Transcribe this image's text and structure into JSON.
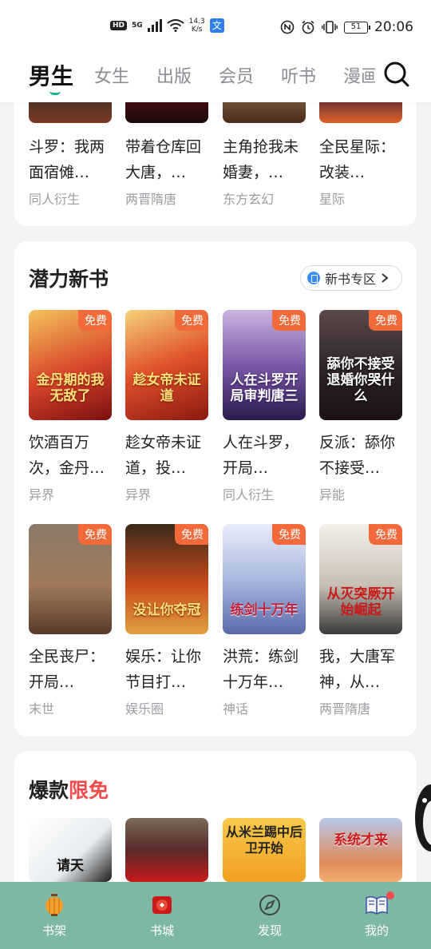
{
  "status_bar": {
    "hd": "HD",
    "network": "5G",
    "speed_value": "14.3",
    "speed_unit": "K/s",
    "translate_glyph": "文",
    "battery": "51",
    "time": "20:06",
    "icons": [
      "nfc-icon",
      "alarm-icon",
      "vibrate-icon"
    ]
  },
  "top_tabs": {
    "items": [
      "男生",
      "女生",
      "出版",
      "会员",
      "听书",
      "漫画"
    ],
    "active_index": 0,
    "accent": "#1ab394"
  },
  "card_prev": {
    "books": [
      {
        "title": "斗罗：我两面宿傩…",
        "tag": "同人衍生"
      },
      {
        "title": "带着仓库回大唐，…",
        "tag": "两晋隋唐"
      },
      {
        "title": "主角抢我未婚妻，…",
        "tag": "东方玄幻"
      },
      {
        "title": "全民星际：改装…",
        "tag": "星际"
      }
    ]
  },
  "potential": {
    "title": "潜力新书",
    "zone_label": "新书专区",
    "free_label": "免费",
    "rows": [
      [
        {
          "title": "饮酒百万次，金丹…",
          "tag": "异界",
          "cover_text": "金丹期的我无敌了"
        },
        {
          "title": "趁女帝未证道，投…",
          "tag": "异界",
          "cover_text": "趁女帝未证道"
        },
        {
          "title": "人在斗罗，开局…",
          "tag": "同人衍生",
          "cover_text": "人在斗罗开局审判唐三"
        },
        {
          "title": "反派：舔你不接受…",
          "tag": "异能",
          "cover_text": "舔你不接受退婚你哭什么"
        }
      ],
      [
        {
          "title": "全民丧尸：开局…",
          "tag": "末世",
          "cover_text": ""
        },
        {
          "title": "娱乐：让你节目打…",
          "tag": "娱乐圈",
          "cover_text": "没让你夺冠"
        },
        {
          "title": "洪荒：练剑十万年…",
          "tag": "神话",
          "cover_text": "练剑十万年"
        },
        {
          "title": "我，大唐军神，从…",
          "tag": "两晋隋唐",
          "cover_text": "从灭突厥开始崛起"
        }
      ]
    ]
  },
  "hot_free": {
    "title_part1": "爆款",
    "title_part2": "限免",
    "covers": [
      "请天",
      "",
      "从米兰踢中后卫开始",
      "系统才来"
    ]
  },
  "bottom_nav": {
    "items": [
      "书架",
      "书城",
      "发现",
      "我的"
    ],
    "active_index": 1
  }
}
